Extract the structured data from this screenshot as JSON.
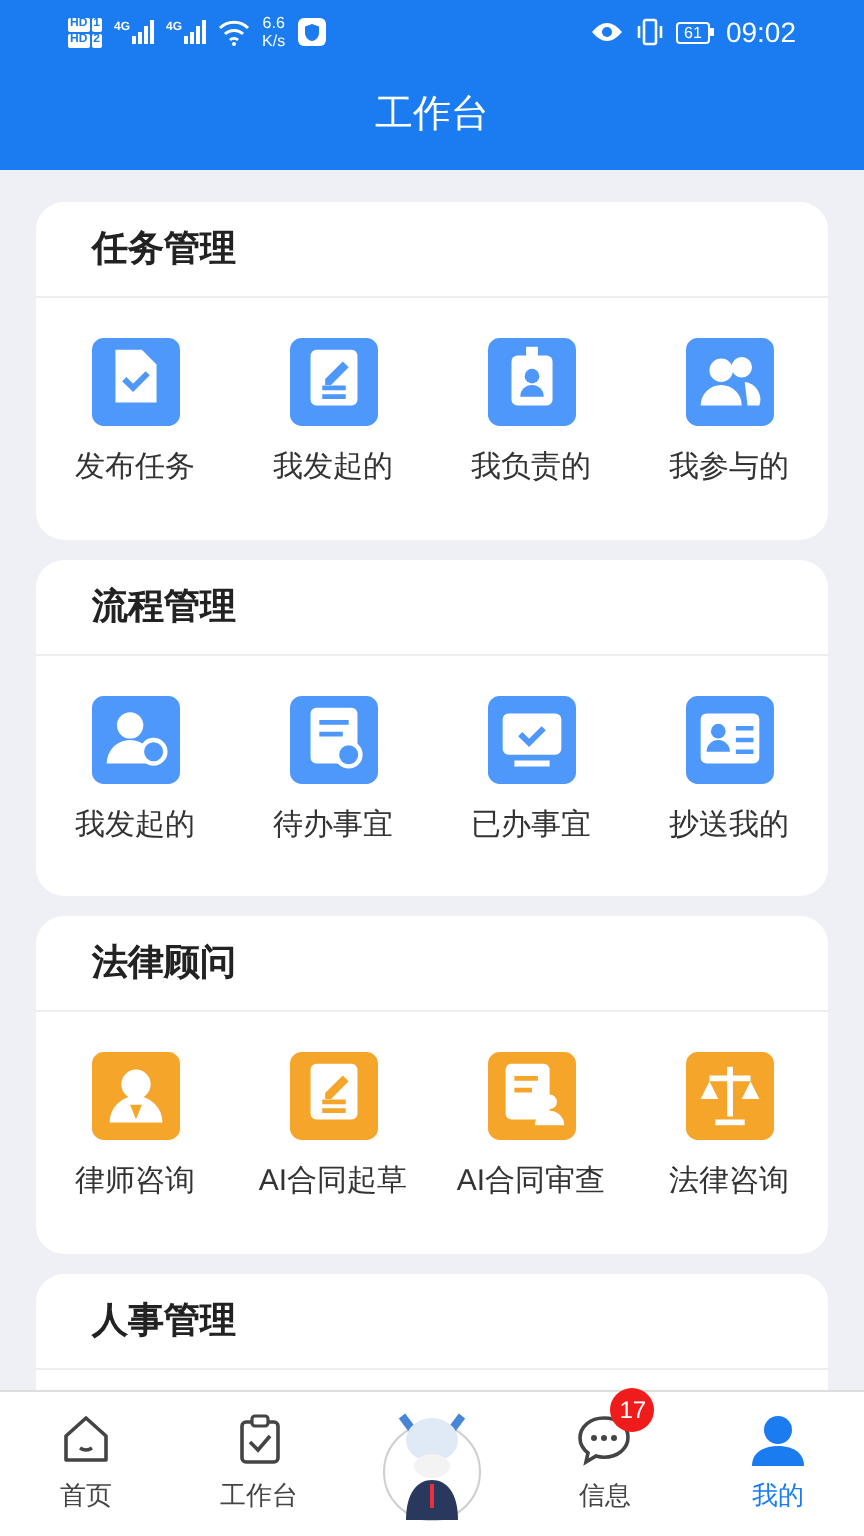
{
  "status_bar": {
    "sims": [
      {
        "badge": "HD",
        "slot": "1"
      },
      {
        "badge": "HD",
        "slot": "2"
      }
    ],
    "networks": [
      "4G",
      "4G"
    ],
    "speed_value": "6.6",
    "speed_unit": "K/s",
    "battery": "61",
    "time": "09:02"
  },
  "header": {
    "title": "工作台"
  },
  "sections": [
    {
      "title": "任务管理",
      "color": "#4e97fb",
      "items": [
        {
          "label": "发布任务",
          "kind": "doc-check"
        },
        {
          "label": "我发起的",
          "kind": "doc-edit"
        },
        {
          "label": "我负责的",
          "kind": "badge"
        },
        {
          "label": "我参与的",
          "kind": "users"
        }
      ]
    },
    {
      "title": "流程管理",
      "color": "#4e97fb",
      "items": [
        {
          "label": "我发起的",
          "kind": "user-send"
        },
        {
          "label": "待办事宜",
          "kind": "doc-clock"
        },
        {
          "label": "已办事宜",
          "kind": "monitor-check"
        },
        {
          "label": "抄送我的",
          "kind": "card"
        }
      ]
    },
    {
      "title": "法律顾问",
      "color": "#f5a52a",
      "items": [
        {
          "label": "律师咨询",
          "kind": "lawyer"
        },
        {
          "label": "AI合同起草",
          "kind": "doc-edit"
        },
        {
          "label": "AI合同审查",
          "kind": "doc-user"
        },
        {
          "label": "法律咨询",
          "kind": "scale"
        }
      ]
    },
    {
      "title": "人事管理"
    }
  ],
  "tab_bar": [
    {
      "kind": "home",
      "label": "首页",
      "selected": false
    },
    {
      "kind": "work",
      "label": "工作台",
      "selected": false
    },
    {
      "kind": "mascot",
      "selected": false
    },
    {
      "kind": "messages",
      "label": "信息",
      "badge": "17",
      "selected": false
    },
    {
      "kind": "mine",
      "label": "我的",
      "selected": true
    }
  ]
}
